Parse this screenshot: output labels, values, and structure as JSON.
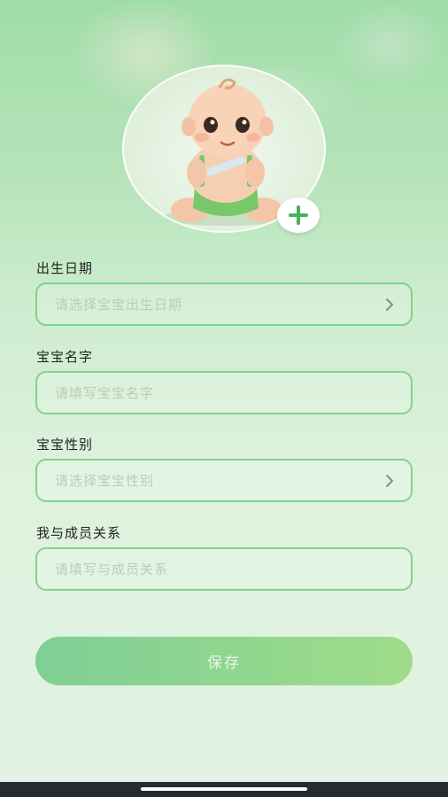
{
  "avatar": {
    "image": "baby-photo",
    "add_icon": "plus-icon",
    "accent": "#45b25a"
  },
  "form": {
    "birth_date": {
      "label": "出生日期",
      "placeholder": "请选择宝宝出生日期",
      "icon": "chevron-right-icon"
    },
    "baby_name": {
      "label": "宝宝名字",
      "placeholder": "请填写宝宝名字"
    },
    "baby_gender": {
      "label": "宝宝性别",
      "placeholder": "请选择宝宝性别",
      "icon": "chevron-right-icon"
    },
    "relationship": {
      "label": "我与成员关系",
      "placeholder": "请填写与成员关系"
    }
  },
  "actions": {
    "save_label": "保存"
  },
  "colors": {
    "field_border": "#7fd38c",
    "button_gradient_start": "#7fcf95",
    "button_gradient_end": "#9fdc8a"
  }
}
